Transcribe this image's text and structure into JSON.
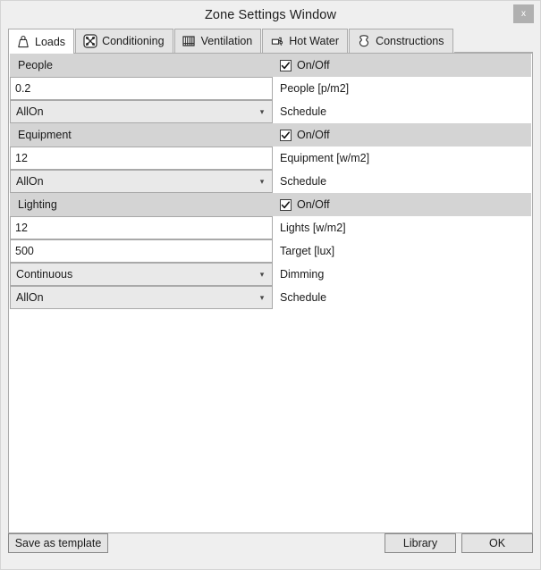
{
  "window": {
    "title": "Zone Settings Window",
    "close_label": "x"
  },
  "tabs": [
    {
      "label": "Loads",
      "icon": "weight-icon",
      "active": true
    },
    {
      "label": "Conditioning",
      "icon": "fan-icon",
      "active": false
    },
    {
      "label": "Ventilation",
      "icon": "vent-grille-icon",
      "active": false
    },
    {
      "label": "Hot Water",
      "icon": "faucet-icon",
      "active": false
    },
    {
      "label": "Constructions",
      "icon": "hide-layer-icon",
      "active": false
    }
  ],
  "sections": [
    {
      "title": "People",
      "toggle": {
        "label": "On/Off",
        "checked": true
      },
      "rows": [
        {
          "kind": "textbox",
          "value": "0.2",
          "label": "People [p/m2]"
        },
        {
          "kind": "combo",
          "value": "AllOn",
          "label": "Schedule"
        }
      ]
    },
    {
      "title": "Equipment",
      "toggle": {
        "label": "On/Off",
        "checked": true
      },
      "rows": [
        {
          "kind": "textbox",
          "value": "12",
          "label": "Equipment [w/m2]"
        },
        {
          "kind": "combo",
          "value": "AllOn",
          "label": "Schedule"
        }
      ]
    },
    {
      "title": "Lighting",
      "toggle": {
        "label": "On/Off",
        "checked": true
      },
      "rows": [
        {
          "kind": "textbox",
          "value": "12",
          "label": "Lights [w/m2]"
        },
        {
          "kind": "textbox",
          "value": "500",
          "label": "Target [lux]"
        },
        {
          "kind": "combo",
          "value": "Continuous",
          "label": "Dimming"
        },
        {
          "kind": "combo",
          "value": "AllOn",
          "label": "Schedule"
        }
      ]
    }
  ],
  "footer": {
    "save_template_label": "Save as template",
    "library_label": "Library",
    "ok_label": "OK"
  },
  "colors": {
    "window_bg": "#efefef",
    "section_header_bg": "#d4d4d4",
    "tab_active_bg": "#ffffff",
    "tab_inactive_bg": "#e4e4e4",
    "close_btn_bg": "#b0b0b0"
  }
}
